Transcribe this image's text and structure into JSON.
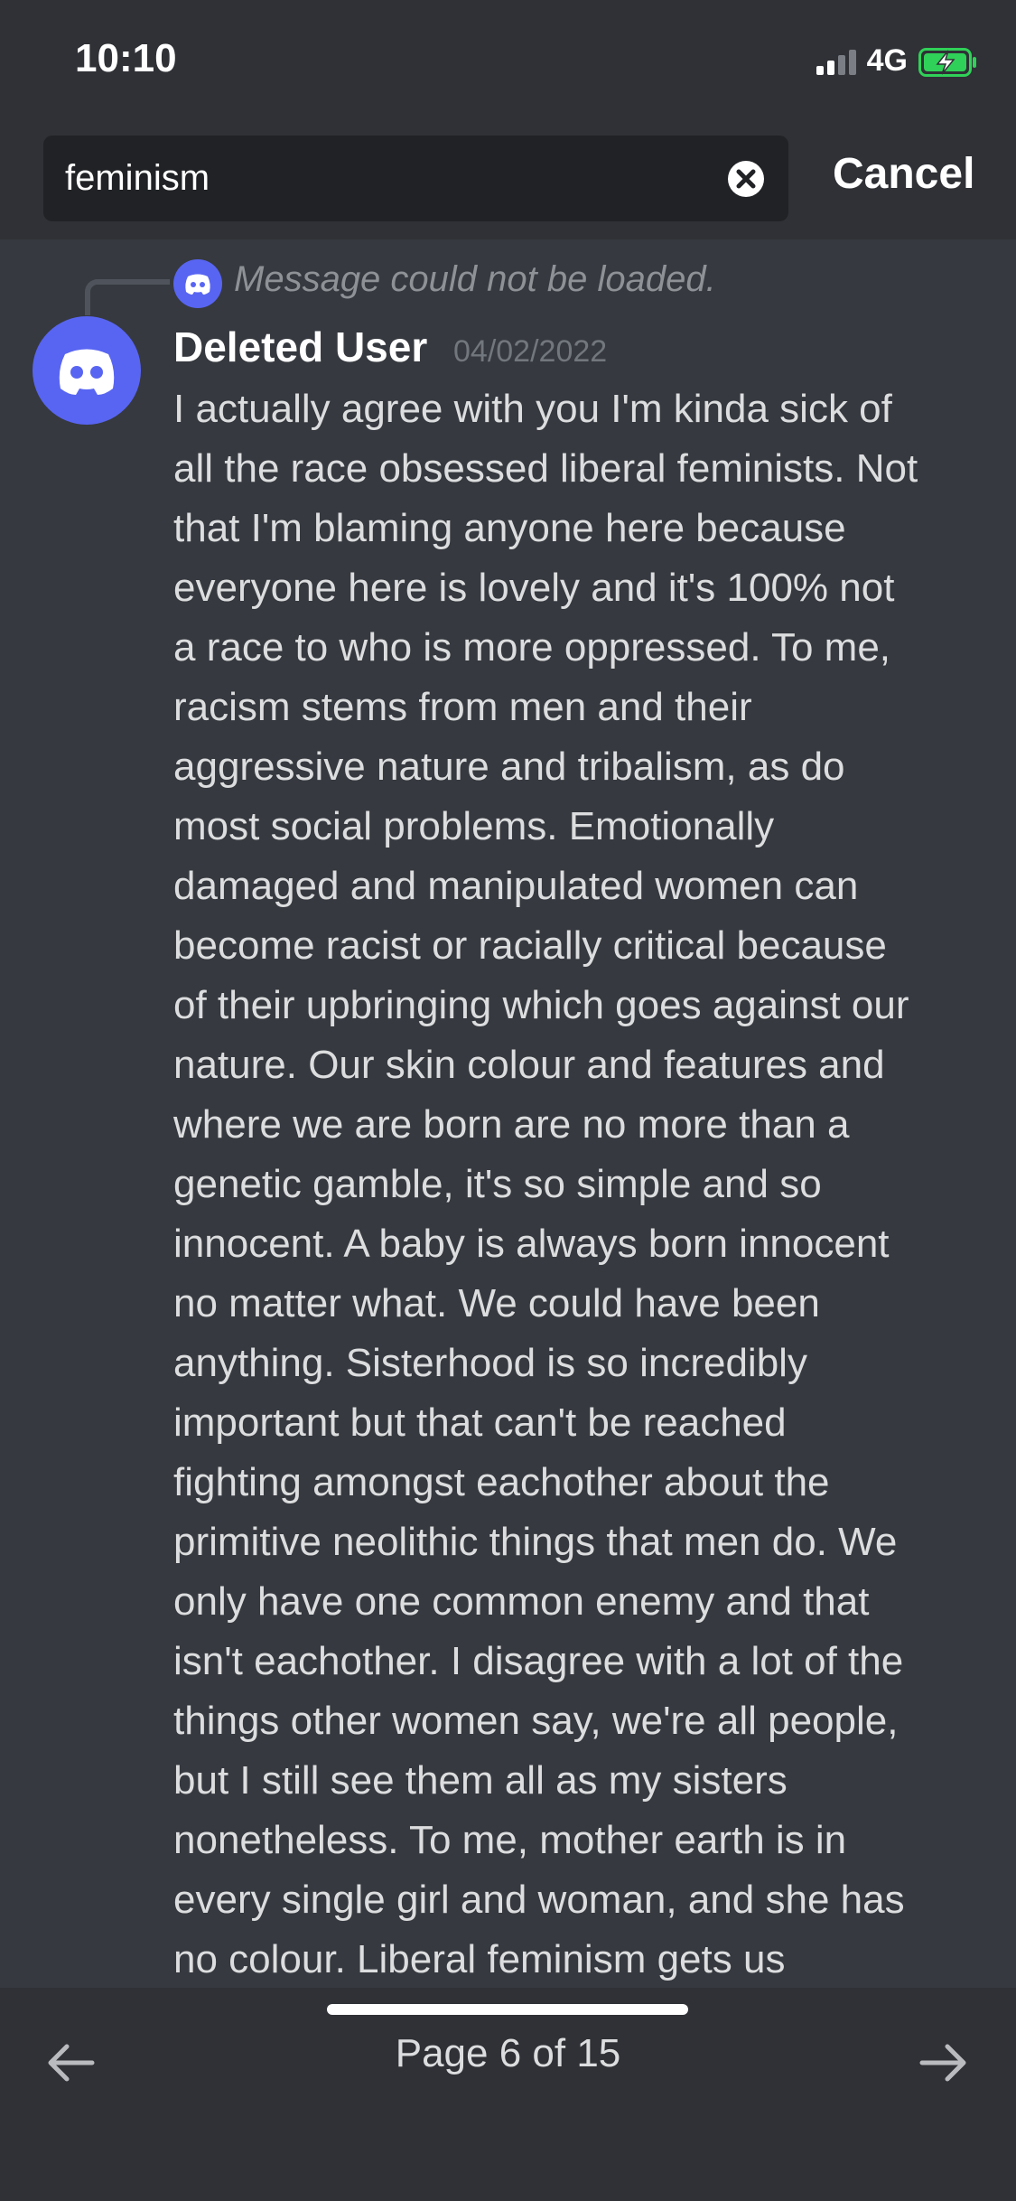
{
  "status_bar": {
    "time": "10:10",
    "network": "4G"
  },
  "search": {
    "value": "feminism",
    "cancel_label": "Cancel"
  },
  "message": {
    "reply_text": "Message could not be loaded.",
    "author": "Deleted User",
    "timestamp": "04/02/2022",
    "lines": [
      "I actually agree with you I'm kinda sick of",
      "all the race obsessed liberal feminists. Not",
      "that I'm blaming anyone here because",
      "everyone here is lovely and it's 100% not",
      "a race to who is more oppressed. To me,",
      "racism stems from men and their",
      "aggressive nature and tribalism, as do",
      "most social problems. Emotionally",
      "damaged and manipulated women can",
      "become racist or racially critical because",
      "of their upbringing which goes against our",
      "nature. Our skin colour and features and",
      "where we are born are no more than a",
      "genetic gamble, it's so simple and so",
      "innocent. A baby is always born innocent",
      "no matter what. We could have been",
      "anything. Sisterhood is so incredibly",
      "important but that can't be reached",
      "fighting amongst eachother about the",
      "primitive neolithic things that men do. We",
      "only have one common enemy and that",
      "isn't eachother. I disagree with a lot of the",
      "things other women say, we're all people,",
      "but I still see them all as my sisters",
      "nonetheless. To me, mother earth is in",
      "every single girl and woman, and she has",
      "no colour. Liberal feminism gets us"
    ]
  },
  "pagination": {
    "label": "Page 6 of 15"
  },
  "colors": {
    "background": "#36393f",
    "header": "#2f3136",
    "search_field": "#202225",
    "blurple": "#5865f2",
    "text": "#dcddde",
    "muted": "#8e9297",
    "battery_green": "#30d158"
  },
  "icons": {
    "clear": "clear-search-icon",
    "avatar": "discord-logo-icon",
    "prev": "arrow-left-icon",
    "next": "arrow-right-icon",
    "battery": "battery-charging-icon",
    "signal": "signal-bars-icon"
  }
}
